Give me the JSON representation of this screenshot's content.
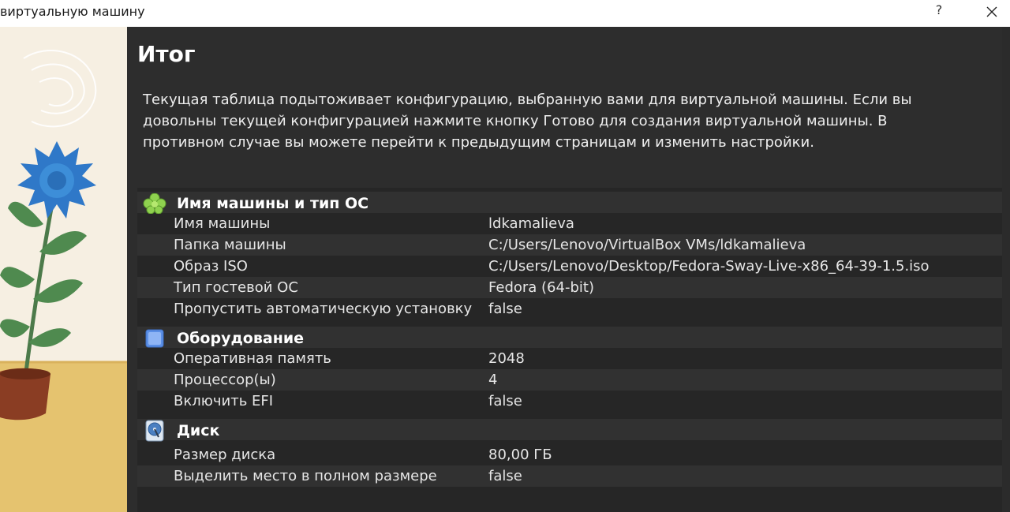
{
  "window": {
    "title": "виртуальную машину",
    "help_label": "?",
    "close_icon": "close-icon"
  },
  "page": {
    "heading": "Итог",
    "description": "Текущая таблица подытоживает конфигурацию, выбранную вами для виртуальной машины. Если вы довольны текущей конфигурацией нажмите кнопку Готово для создания виртуальной машины. В противном случае вы можете перейти к предыдущим страницам и изменить настройки."
  },
  "summary": {
    "name_section": {
      "title": "Имя машины и тип ОС",
      "icon": "os-type-icon",
      "rows": [
        {
          "key": "Имя машины",
          "value": "ldkamalieva"
        },
        {
          "key": "Папка машины",
          "value": "C:/Users/Lenovo/VirtualBox VMs/ldkamalieva"
        },
        {
          "key": "Образ ISO",
          "value": "C:/Users/Lenovo/Desktop/Fedora-Sway-Live-x86_64-39-1.5.iso"
        },
        {
          "key": "Тип гостевой ОС",
          "value": "Fedora (64-bit)"
        },
        {
          "key": "Пропустить автоматическую установку",
          "value": "false"
        }
      ]
    },
    "hardware_section": {
      "title": "Оборудование",
      "icon": "hardware-chip-icon",
      "rows": [
        {
          "key": "Оперативная память",
          "value": "2048"
        },
        {
          "key": "Процессор(ы)",
          "value": "4"
        },
        {
          "key": "Включить EFI",
          "value": "false"
        }
      ]
    },
    "disk_section": {
      "title": "Диск",
      "icon": "hard-disk-icon",
      "rows": [
        {
          "key": "Размер диска",
          "value": "80,00 ГБ"
        },
        {
          "key": "Выделить место в полном размере",
          "value": "false"
        }
      ]
    }
  },
  "colors": {
    "accent_green": "#8fd14f",
    "hardware_blue": "#5b8fe6",
    "flower_blue": "#2f78c8",
    "pot_brown": "#8a3d23"
  }
}
